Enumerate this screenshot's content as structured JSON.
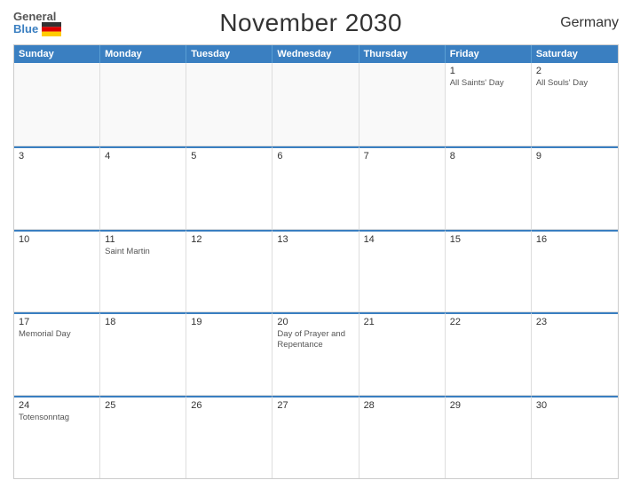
{
  "header": {
    "logo_general": "General",
    "logo_blue": "Blue",
    "title": "November 2030",
    "country": "Germany"
  },
  "days_of_week": [
    "Sunday",
    "Monday",
    "Tuesday",
    "Wednesday",
    "Thursday",
    "Friday",
    "Saturday"
  ],
  "weeks": [
    [
      {
        "day": "",
        "holiday": ""
      },
      {
        "day": "",
        "holiday": ""
      },
      {
        "day": "",
        "holiday": ""
      },
      {
        "day": "",
        "holiday": ""
      },
      {
        "day": "",
        "holiday": ""
      },
      {
        "day": "1",
        "holiday": "All Saints' Day"
      },
      {
        "day": "2",
        "holiday": "All Souls' Day"
      }
    ],
    [
      {
        "day": "3",
        "holiday": ""
      },
      {
        "day": "4",
        "holiday": ""
      },
      {
        "day": "5",
        "holiday": ""
      },
      {
        "day": "6",
        "holiday": ""
      },
      {
        "day": "7",
        "holiday": ""
      },
      {
        "day": "8",
        "holiday": ""
      },
      {
        "day": "9",
        "holiday": ""
      }
    ],
    [
      {
        "day": "10",
        "holiday": ""
      },
      {
        "day": "11",
        "holiday": "Saint Martin"
      },
      {
        "day": "12",
        "holiday": ""
      },
      {
        "day": "13",
        "holiday": ""
      },
      {
        "day": "14",
        "holiday": ""
      },
      {
        "day": "15",
        "holiday": ""
      },
      {
        "day": "16",
        "holiday": ""
      }
    ],
    [
      {
        "day": "17",
        "holiday": "Memorial Day"
      },
      {
        "day": "18",
        "holiday": ""
      },
      {
        "day": "19",
        "holiday": ""
      },
      {
        "day": "20",
        "holiday": "Day of Prayer and Repentance"
      },
      {
        "day": "21",
        "holiday": ""
      },
      {
        "day": "22",
        "holiday": ""
      },
      {
        "day": "23",
        "holiday": ""
      }
    ],
    [
      {
        "day": "24",
        "holiday": "Totensonntag"
      },
      {
        "day": "25",
        "holiday": ""
      },
      {
        "day": "26",
        "holiday": ""
      },
      {
        "day": "27",
        "holiday": ""
      },
      {
        "day": "28",
        "holiday": ""
      },
      {
        "day": "29",
        "holiday": ""
      },
      {
        "day": "30",
        "holiday": ""
      }
    ]
  ]
}
